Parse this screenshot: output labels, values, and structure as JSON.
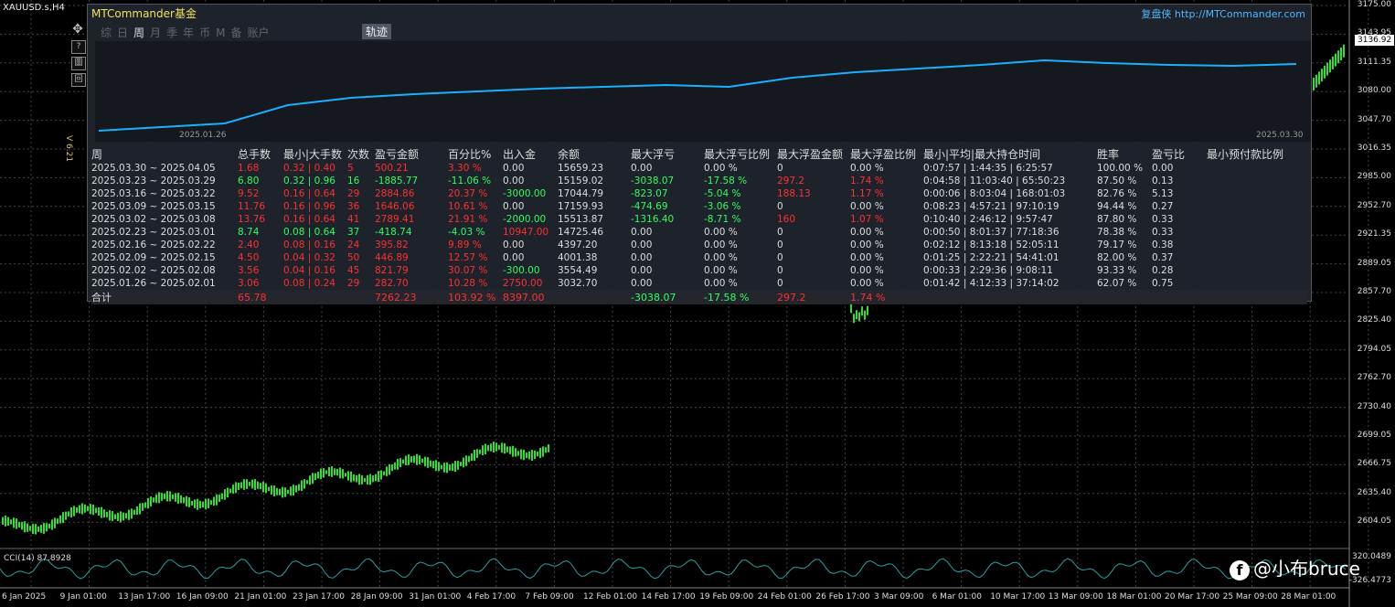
{
  "chart": {
    "symbol": "XAUUSD.s,H4",
    "current_price": "3136.92",
    "y_axis": [
      "3175.00",
      "3143.95",
      "3111.35",
      "3080.00",
      "3047.70",
      "3016.35",
      "2985.00",
      "2952.70",
      "2921.35",
      "2889.05",
      "2857.70",
      "2825.40",
      "2794.05",
      "2762.70",
      "2730.40",
      "2699.05",
      "2666.75",
      "2635.40",
      "2604.05"
    ],
    "x_axis": [
      "6 Jan 2025",
      "9 Jan 01:00",
      "13 Jan 17:00",
      "16 Jan 09:00",
      "21 Jan 01:00",
      "23 Jan 17:00",
      "28 Jan 09:00",
      "31 Jan 01:00",
      "4 Feb 17:00",
      "7 Feb 09:00",
      "12 Feb 01:00",
      "14 Feb 17:00",
      "19 Feb 09:00",
      "24 Feb 01:00",
      "26 Feb 17:00",
      "3 Mar 09:00",
      "6 Mar 01:00",
      "10 Mar 17:00",
      "13 Mar 09:00",
      "18 Mar 01:00",
      "20 Mar 17:00",
      "25 Mar 09:00",
      "28 Mar 01:00"
    ],
    "cci_label": "CCI(14) 87.8928",
    "cci_axis": [
      "320.0489",
      "-326.4773"
    ],
    "version": "V 6.21",
    "side_buttons": [
      "?",
      "圖",
      "回"
    ]
  },
  "panel": {
    "brand": "MTCommander",
    "brand_suffix": "基金",
    "link": "复盘侠 http://MTCommander.com",
    "tabs": [
      "综",
      "日",
      "周",
      "月",
      "季",
      "年",
      "币",
      "M",
      "备",
      "账户"
    ],
    "active_tab": "周",
    "trail_button": "轨迹",
    "equity_start_date": "2025.01.26",
    "equity_end_date": "2025.03.30",
    "equity_curve": [
      0.02,
      0.06,
      0.1,
      0.3,
      0.38,
      0.42,
      0.45,
      0.48,
      0.5,
      0.52,
      0.5,
      0.6,
      0.66,
      0.7,
      0.74,
      0.79,
      0.76,
      0.74,
      0.73,
      0.75
    ]
  },
  "stats": {
    "headers": [
      "周",
      "总手数",
      "最小|大手数",
      "次数",
      "盈亏金额",
      "百分比%",
      "出入金",
      "余额",
      "最大浮亏",
      "最大浮亏比例",
      "最大浮盈金额",
      "最大浮盈比例",
      "最小|平均|最大持仓时间",
      "胜率",
      "盈亏比",
      "最小预付款比例"
    ],
    "rows": [
      [
        "2025.03.30 ~ 2025.04.05",
        "1.68",
        "0.32 | 0.40",
        "5",
        "500.21",
        "3.30 %",
        "0.00",
        "15659.23",
        "0.00",
        "0.00 %",
        "0",
        "0.00 %",
        "0:07:57 | 1:44:35 | 6:25:57",
        "100.00 %",
        "0.00",
        ""
      ],
      [
        "2025.03.23 ~ 2025.03.29",
        "6.80",
        "0.32 | 0.96",
        "16",
        "-1885.77",
        "-11.06 %",
        "0.00",
        "15159.02",
        "-3038.07",
        "-17.58 %",
        "297.2",
        "1.74 %",
        "0:04:58 | 11:03:40 | 65:50:23",
        "87.50 %",
        "0.13",
        ""
      ],
      [
        "2025.03.16 ~ 2025.03.22",
        "9.52",
        "0.16 | 0.64",
        "29",
        "2884.86",
        "20.37 %",
        "-3000.00",
        "17044.79",
        "-823.07",
        "-5.04 %",
        "188.13",
        "1.17 %",
        "0:00:06 | 8:03:04 | 168:01:03",
        "82.76 %",
        "5.13",
        ""
      ],
      [
        "2025.03.09 ~ 2025.03.15",
        "11.76",
        "0.16 | 0.96",
        "36",
        "1646.06",
        "10.61 %",
        "0.00",
        "17159.93",
        "-474.69",
        "-3.06 %",
        "0",
        "0.00 %",
        "0:08:23 | 4:57:21 | 97:10:19",
        "94.44 %",
        "0.27",
        ""
      ],
      [
        "2025.03.02 ~ 2025.03.08",
        "13.76",
        "0.16 | 0.64",
        "41",
        "2789.41",
        "21.91 %",
        "-2000.00",
        "15513.87",
        "-1316.40",
        "-8.71 %",
        "160",
        "1.07 %",
        "0:10:40 | 2:46:12 | 9:57:47",
        "87.80 %",
        "0.33",
        ""
      ],
      [
        "2025.02.23 ~ 2025.03.01",
        "8.74",
        "0.08 | 0.64",
        "37",
        "-418.74",
        "-4.03 %",
        "10947.00",
        "14725.46",
        "0.00",
        "0.00 %",
        "0",
        "0.00 %",
        "0:00:50 | 8:01:37 | 77:18:36",
        "78.38 %",
        "0.33",
        ""
      ],
      [
        "2025.02.16 ~ 2025.02.22",
        "2.40",
        "0.08 | 0.16",
        "24",
        "395.82",
        "9.89 %",
        "0.00",
        "4397.20",
        "0.00",
        "0.00 %",
        "0",
        "0.00 %",
        "0:02:12 | 8:13:18 | 52:05:11",
        "79.17 %",
        "0.38",
        ""
      ],
      [
        "2025.02.09 ~ 2025.02.15",
        "4.50",
        "0.04 | 0.32",
        "50",
        "446.89",
        "12.57 %",
        "0.00",
        "4001.38",
        "0.00",
        "0.00 %",
        "0",
        "0.00 %",
        "0:01:25 | 2:22:21 | 54:41:01",
        "82.00 %",
        "0.37",
        ""
      ],
      [
        "2025.02.02 ~ 2025.02.08",
        "3.56",
        "0.04 | 0.16",
        "45",
        "821.79",
        "30.07 %",
        "-300.00",
        "3554.49",
        "0.00",
        "0.00 %",
        "0",
        "0.00 %",
        "0:00:33 | 2:29:36 | 9:08:11",
        "93.33 %",
        "0.28",
        ""
      ],
      [
        "2025.01.26 ~ 2025.02.01",
        "3.06",
        "0.08 | 0.24",
        "29",
        "282.70",
        "10.28 %",
        "2750.00",
        "3032.70",
        "0.00",
        "0.00 %",
        "0",
        "0.00 %",
        "0:01:42 | 4:12:33 | 37:14:02",
        "62.07 %",
        "0.75",
        ""
      ]
    ],
    "row_colors": [
      [
        "w",
        "r",
        "r",
        "r",
        "r",
        "r",
        "w",
        "w",
        "w",
        "w",
        "w",
        "w",
        "w",
        "w",
        "w",
        "w"
      ],
      [
        "w",
        "g",
        "g",
        "g",
        "g",
        "g",
        "w",
        "w",
        "g",
        "g",
        "r",
        "r",
        "w",
        "w",
        "w",
        "w"
      ],
      [
        "w",
        "r",
        "r",
        "r",
        "r",
        "r",
        "g",
        "w",
        "g",
        "g",
        "r",
        "r",
        "w",
        "w",
        "w",
        "w"
      ],
      [
        "w",
        "r",
        "r",
        "r",
        "r",
        "r",
        "w",
        "w",
        "g",
        "g",
        "w",
        "w",
        "w",
        "w",
        "w",
        "w"
      ],
      [
        "w",
        "r",
        "r",
        "r",
        "r",
        "r",
        "g",
        "w",
        "g",
        "g",
        "r",
        "r",
        "w",
        "w",
        "w",
        "w"
      ],
      [
        "w",
        "g",
        "g",
        "g",
        "g",
        "g",
        "r",
        "w",
        "w",
        "w",
        "w",
        "w",
        "w",
        "w",
        "w",
        "w"
      ],
      [
        "w",
        "r",
        "r",
        "r",
        "r",
        "r",
        "w",
        "w",
        "w",
        "w",
        "w",
        "w",
        "w",
        "w",
        "w",
        "w"
      ],
      [
        "w",
        "r",
        "r",
        "r",
        "r",
        "r",
        "w",
        "w",
        "w",
        "w",
        "w",
        "w",
        "w",
        "w",
        "w",
        "w"
      ],
      [
        "w",
        "r",
        "r",
        "r",
        "r",
        "r",
        "g",
        "w",
        "w",
        "w",
        "w",
        "w",
        "w",
        "w",
        "w",
        "w"
      ],
      [
        "w",
        "r",
        "r",
        "r",
        "r",
        "r",
        "r",
        "w",
        "w",
        "w",
        "w",
        "w",
        "w",
        "w",
        "w",
        "w"
      ]
    ],
    "total": {
      "label": "合计",
      "lots": "65.78",
      "pnl": "7262.23",
      "pct": "103.92 %",
      "deposit": "8397.00",
      "max_dd": "-3038.07",
      "max_dd_pct": "-17.58 %",
      "max_fp": "297.2",
      "max_fp_pct": "1.74 %"
    }
  },
  "watermark": "@小布bruce",
  "watermark_icon": "f"
}
